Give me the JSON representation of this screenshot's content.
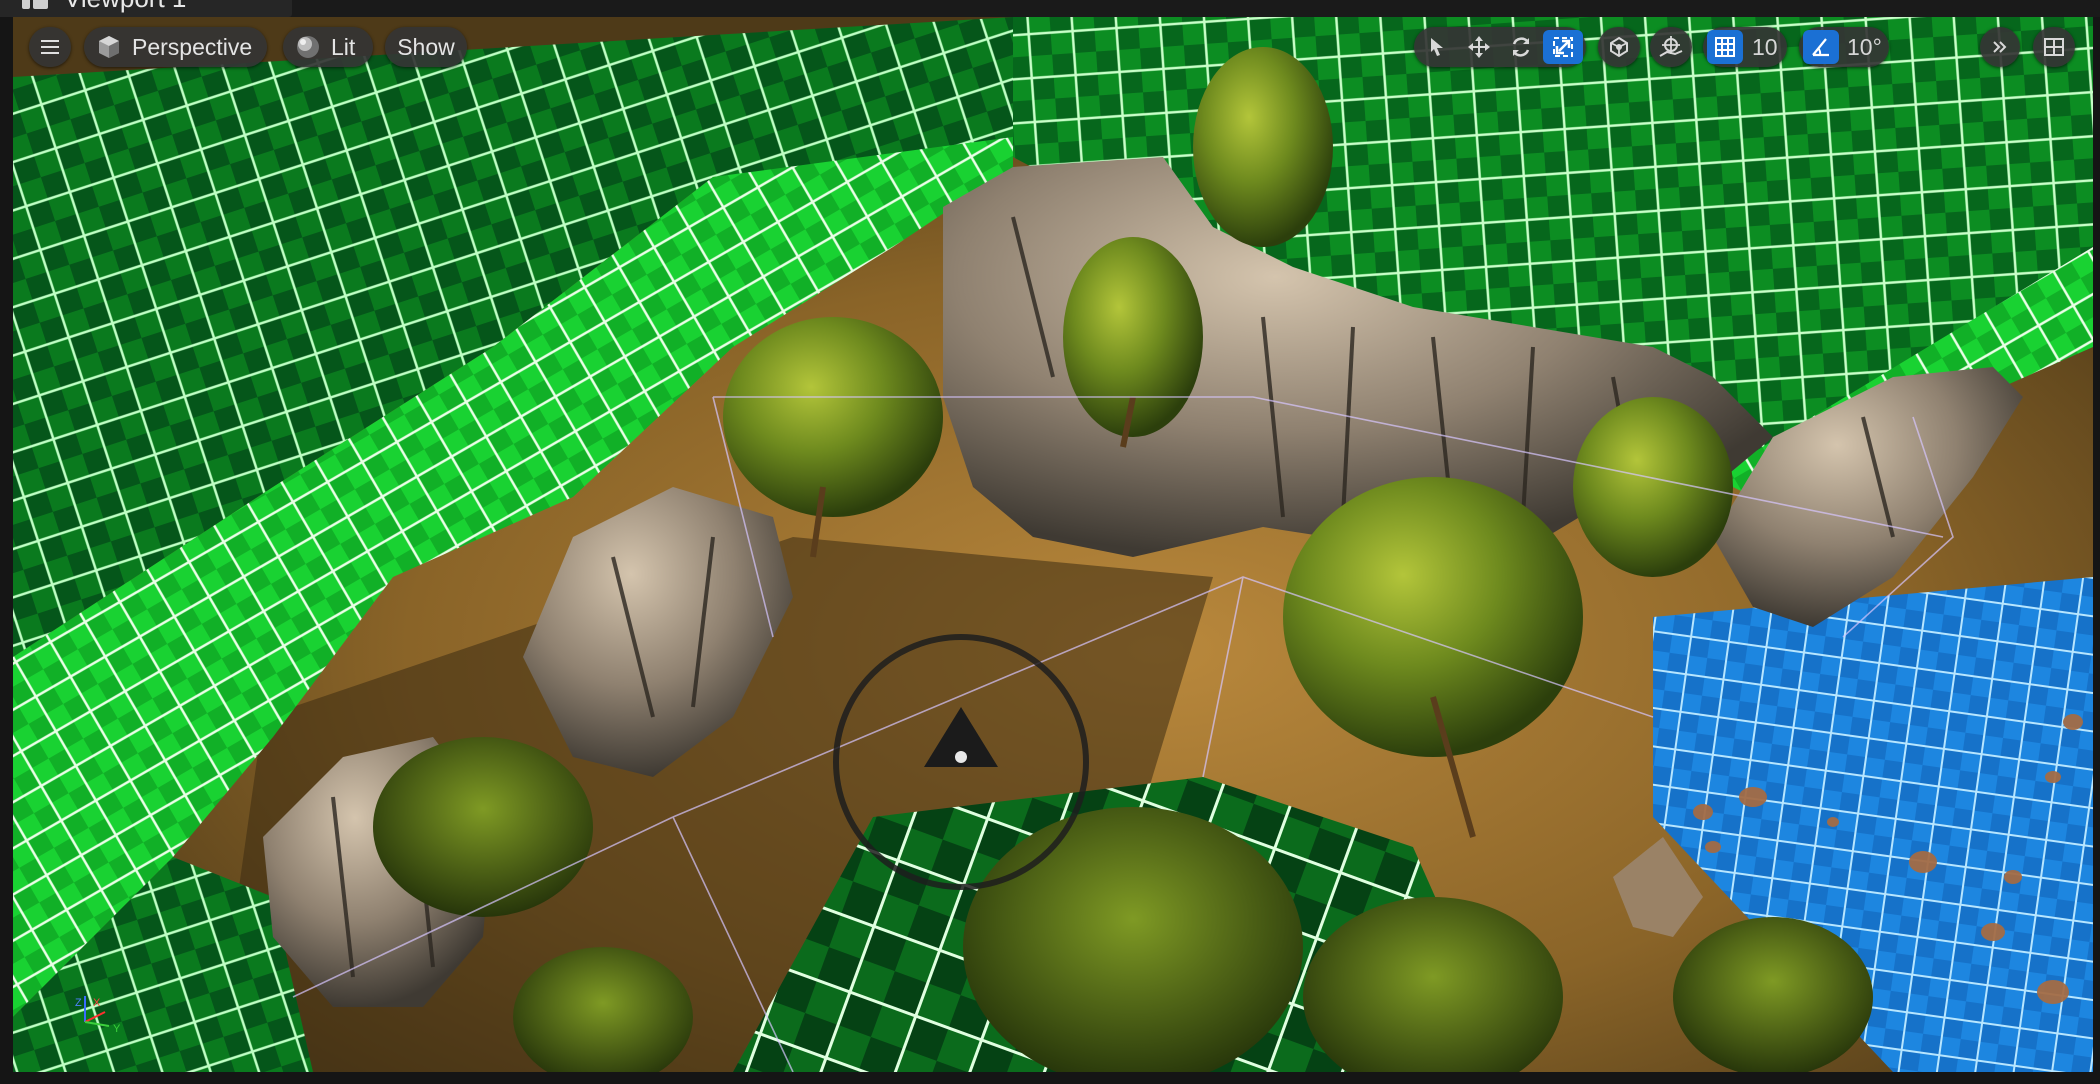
{
  "tab": {
    "title": "Viewport 1"
  },
  "viewport_toolbar": {
    "menu_icon": "hamburger-icon",
    "view_mode": {
      "label": "Perspective",
      "icon": "cube-icon"
    },
    "lighting": {
      "label": "Lit",
      "icon": "sphere-icon"
    },
    "show": {
      "label": "Show"
    },
    "transform_tools": [
      {
        "name": "select",
        "icon": "cursor-arrow-icon",
        "active": false
      },
      {
        "name": "translate",
        "icon": "move-arrows-icon",
        "active": false
      },
      {
        "name": "rotate",
        "icon": "rotate-icon",
        "active": false
      },
      {
        "name": "scale",
        "icon": "scale-icon",
        "active": true
      }
    ],
    "coordinate_space": {
      "icon": "globe-icon"
    },
    "surface_snapping": {
      "icon": "surface-snap-icon"
    },
    "grid_snap": {
      "icon": "grid-icon",
      "value": "10",
      "active": true
    },
    "rotation_snap": {
      "icon": "angle-icon",
      "value": "10°",
      "active": true
    },
    "more": {
      "icon": "double-chevron-icon"
    },
    "layout": {
      "icon": "viewport-layout-icon"
    }
  },
  "axis_indicator": {
    "z": "Z",
    "x": "X",
    "y": "Y"
  },
  "colors": {
    "accent_blue": "#1b70d4",
    "green_mesh": "#17c82a",
    "blue_mesh": "#1e8fe6",
    "toolbar_bg": "#343434"
  }
}
